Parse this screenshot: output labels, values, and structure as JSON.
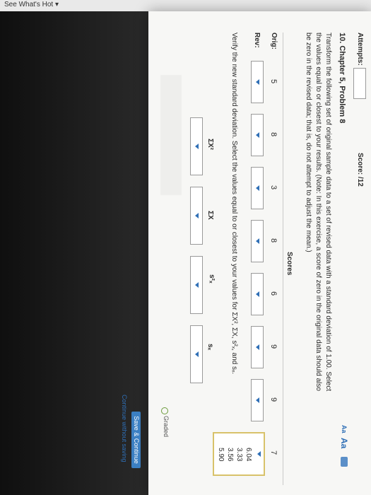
{
  "browser": {
    "whats_hot": "See What's Hot ▾"
  },
  "header": {
    "attempts_label": "Attempts:",
    "score_label": "Score: /12"
  },
  "question": {
    "title": "10. Chapter 5, Problem 8",
    "aa_small": "Aa",
    "aa_large": "Aa",
    "instructions": [
      "Transform the following set of original sample data to a set of revised data with a standard deviation of 1.00. Select",
      "the values equal to or closest to your results. (Note: In this exercise, a score of zero in the original data should also",
      "be zero in the revised data; that is, do not attempt to adjust the mean.)"
    ]
  },
  "table": {
    "header": "Scores",
    "orig_label": "Orig:",
    "rev_label": "Rev:",
    "orig_values": [
      "5",
      "8",
      "3",
      "8",
      "6",
      "9",
      "9",
      "7"
    ],
    "dropdown_options_open": [
      "6.04",
      "3.33",
      "3.56",
      "5.90"
    ]
  },
  "verify": {
    "text": "Verify the new standard deviation. Select the values equal to or closest to your values for ΣX², ΣX, s²ₓ, and sₓ.",
    "col_sumx2": "ΣX²",
    "col_sumx": "ΣX",
    "col_sx2": "s²ₓ",
    "col_sx": "sₓ"
  },
  "footer": {
    "graded": "Graded",
    "save_continue": "Save & Continue",
    "continue_without": "Continue without saving"
  },
  "colors": {
    "accent": "#2f6fb6",
    "highlight": "#d8c26a",
    "button": "#3b7fc2"
  }
}
